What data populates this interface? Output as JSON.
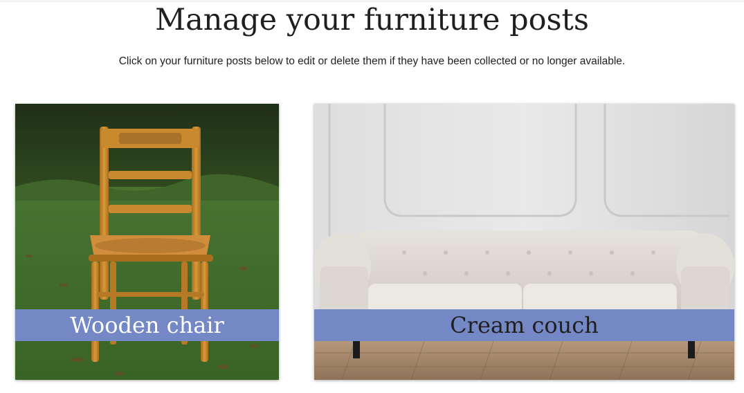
{
  "page": {
    "title": "Manage your furniture posts",
    "subtitle": "Click on your furniture posts below to edit or delete them if they have been collected or no longer available."
  },
  "posts": [
    {
      "label": "Wooden chair",
      "label_color": "#ffffff",
      "banner_color": "#7488c6",
      "icon": "wooden-chair-photo"
    },
    {
      "label": "Cream couch",
      "label_color": "#1f1f1f",
      "banner_color": "#7488c6",
      "icon": "cream-couch-photo"
    }
  ]
}
